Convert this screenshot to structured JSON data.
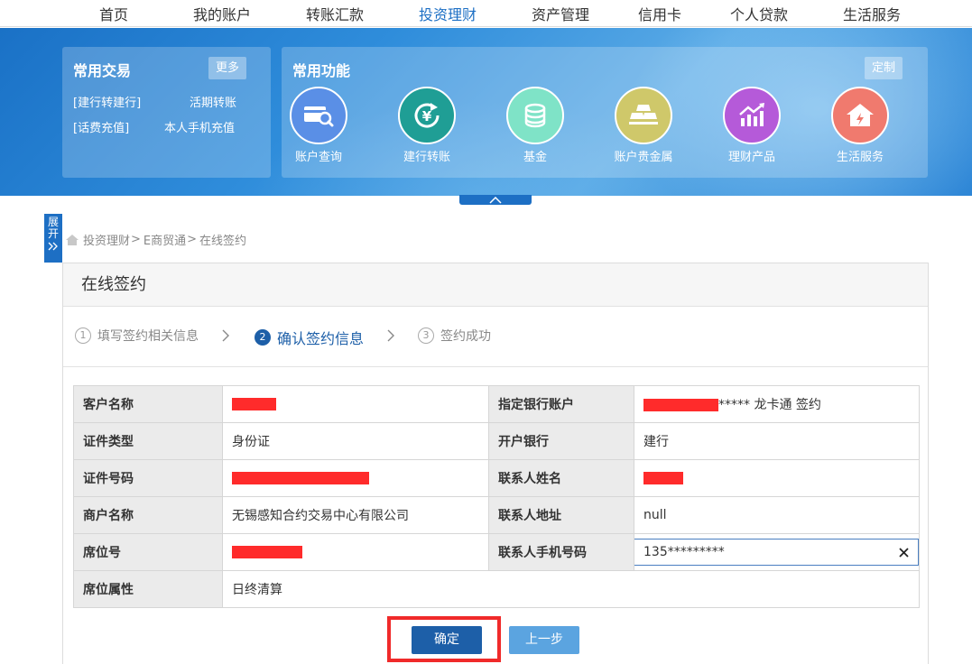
{
  "nav": {
    "items": [
      {
        "label": "首页",
        "active": false
      },
      {
        "label": "我的账户",
        "active": false
      },
      {
        "label": "转账汇款",
        "active": false
      },
      {
        "label": "投资理财",
        "active": true
      },
      {
        "label": "资产管理",
        "active": false
      },
      {
        "label": "信用卡",
        "active": false
      },
      {
        "label": "个人贷款",
        "active": false
      },
      {
        "label": "生活服务",
        "active": false
      }
    ]
  },
  "common_trade": {
    "title": "常用交易",
    "more_label": "更多",
    "links": [
      "[建行转建行]",
      "活期转账",
      "[话费充值]",
      "本人手机充值"
    ]
  },
  "common_functions": {
    "title": "常用功能",
    "customize_label": "定制",
    "items": [
      {
        "label": "账户查询",
        "icon": "account-query-icon",
        "color": "#5a8fe6"
      },
      {
        "label": "建行转账",
        "icon": "yen-transfer-icon",
        "color": "#1f9e95"
      },
      {
        "label": "基金",
        "icon": "coins-icon",
        "color": "#7fe3c7"
      },
      {
        "label": "账户贵金属",
        "icon": "gold-bars-icon",
        "color": "#cfc86a"
      },
      {
        "label": "理财产品",
        "icon": "chart-growth-icon",
        "color": "#b55ad9"
      },
      {
        "label": "生活服务",
        "icon": "house-service-icon",
        "color": "#f07a6e"
      }
    ]
  },
  "side_tab": {
    "label": "展开"
  },
  "breadcrumb": [
    "投资理财",
    "E商贸通",
    "在线签约"
  ],
  "page_title": "在线签约",
  "steps": [
    {
      "num": "1",
      "label": "填写签约相关信息",
      "active": false
    },
    {
      "num": "2",
      "label": "确认签约信息",
      "active": true
    },
    {
      "num": "3",
      "label": "签约成功",
      "active": false
    }
  ],
  "info_table": {
    "rows": [
      {
        "l1": "客户名称",
        "v1": "",
        "l2": "指定银行账户",
        "v2": "***** 龙卡通 签约"
      },
      {
        "l1": "证件类型",
        "v1": "身份证",
        "l2": "开户银行",
        "v2": "建行"
      },
      {
        "l1": "证件号码",
        "v1": "",
        "l2": "联系人姓名",
        "v2": ""
      },
      {
        "l1": "商户名称",
        "v1": "无锡感知合约交易中心有限公司",
        "l2": "联系人地址",
        "v2": "null"
      },
      {
        "l1": "席位号",
        "v1": "",
        "l2": "联系人手机号码",
        "v2": "135*********"
      },
      {
        "l1": "席位属性",
        "v1": "日终清算"
      }
    ]
  },
  "buttons": {
    "confirm": "确定",
    "prev": "上一步"
  },
  "colors": {
    "brand_blue": "#1d5fa8",
    "highlight_red": "#f02a2a",
    "redaction": "#ff2b2b"
  }
}
